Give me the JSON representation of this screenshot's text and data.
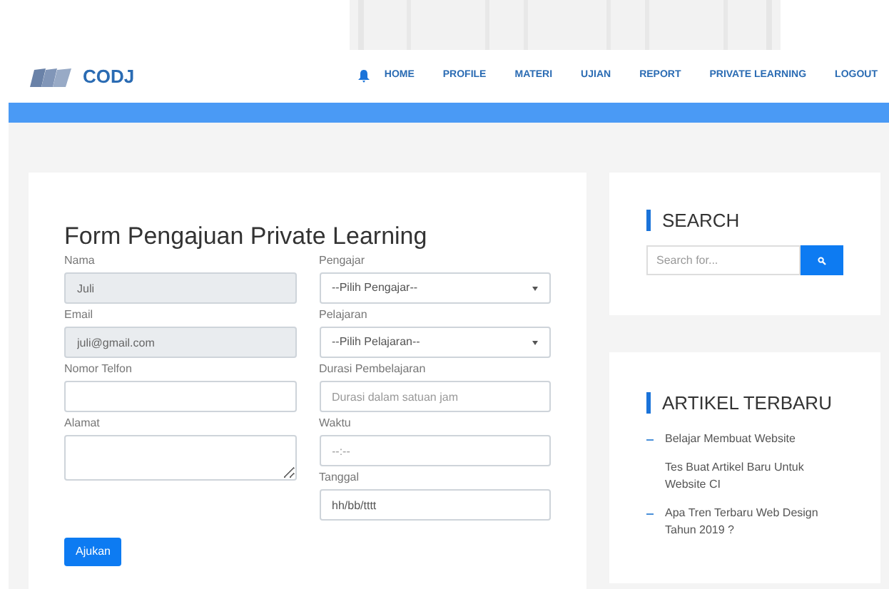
{
  "navbar": {
    "brand": "CODJ",
    "items": [
      "HOME",
      "PROFILE",
      "MATERI",
      "UJIAN",
      "REPORT",
      "PRIVATE LEARNING",
      "LOGOUT"
    ]
  },
  "form": {
    "title": "Form Pengajuan Private Learning",
    "left": [
      {
        "label": "Nama",
        "kind": "input",
        "value": "Juli",
        "disabled": true
      },
      {
        "label": "Email",
        "kind": "input",
        "value": "juli@gmail.com",
        "disabled": true
      },
      {
        "label": "Nomor Telfon",
        "kind": "input",
        "disabled": false
      },
      {
        "label": "Alamat",
        "kind": "textarea"
      }
    ],
    "right": [
      {
        "label": "Pengajar",
        "kind": "select",
        "value": "--Pilih Pengajar--"
      },
      {
        "label": "Pelajaran",
        "kind": "select",
        "value": "--Pilih Pelajaran--"
      },
      {
        "label": "Durasi Pembelajaran",
        "kind": "input",
        "placeholder": "Durasi dalam satuan jam"
      },
      {
        "label": "Waktu",
        "kind": "input",
        "placeholder": "--:--"
      },
      {
        "label": "Tanggal",
        "kind": "input",
        "value": "hh/bb/tttt"
      }
    ],
    "submit": "Ajukan"
  },
  "search": {
    "title": "SEARCH",
    "placeholder": "Search for..."
  },
  "articles": {
    "title": "ARTIKEL TERBARU",
    "items": [
      {
        "text": "Belajar Membuat Website",
        "bullet": true
      },
      {
        "text": "Tes Buat Artikel Baru Untuk Website CI",
        "bullet": false
      },
      {
        "text": "Apa Tren Terbaru Web Design Tahun 2019 ?",
        "bullet": true
      }
    ]
  }
}
